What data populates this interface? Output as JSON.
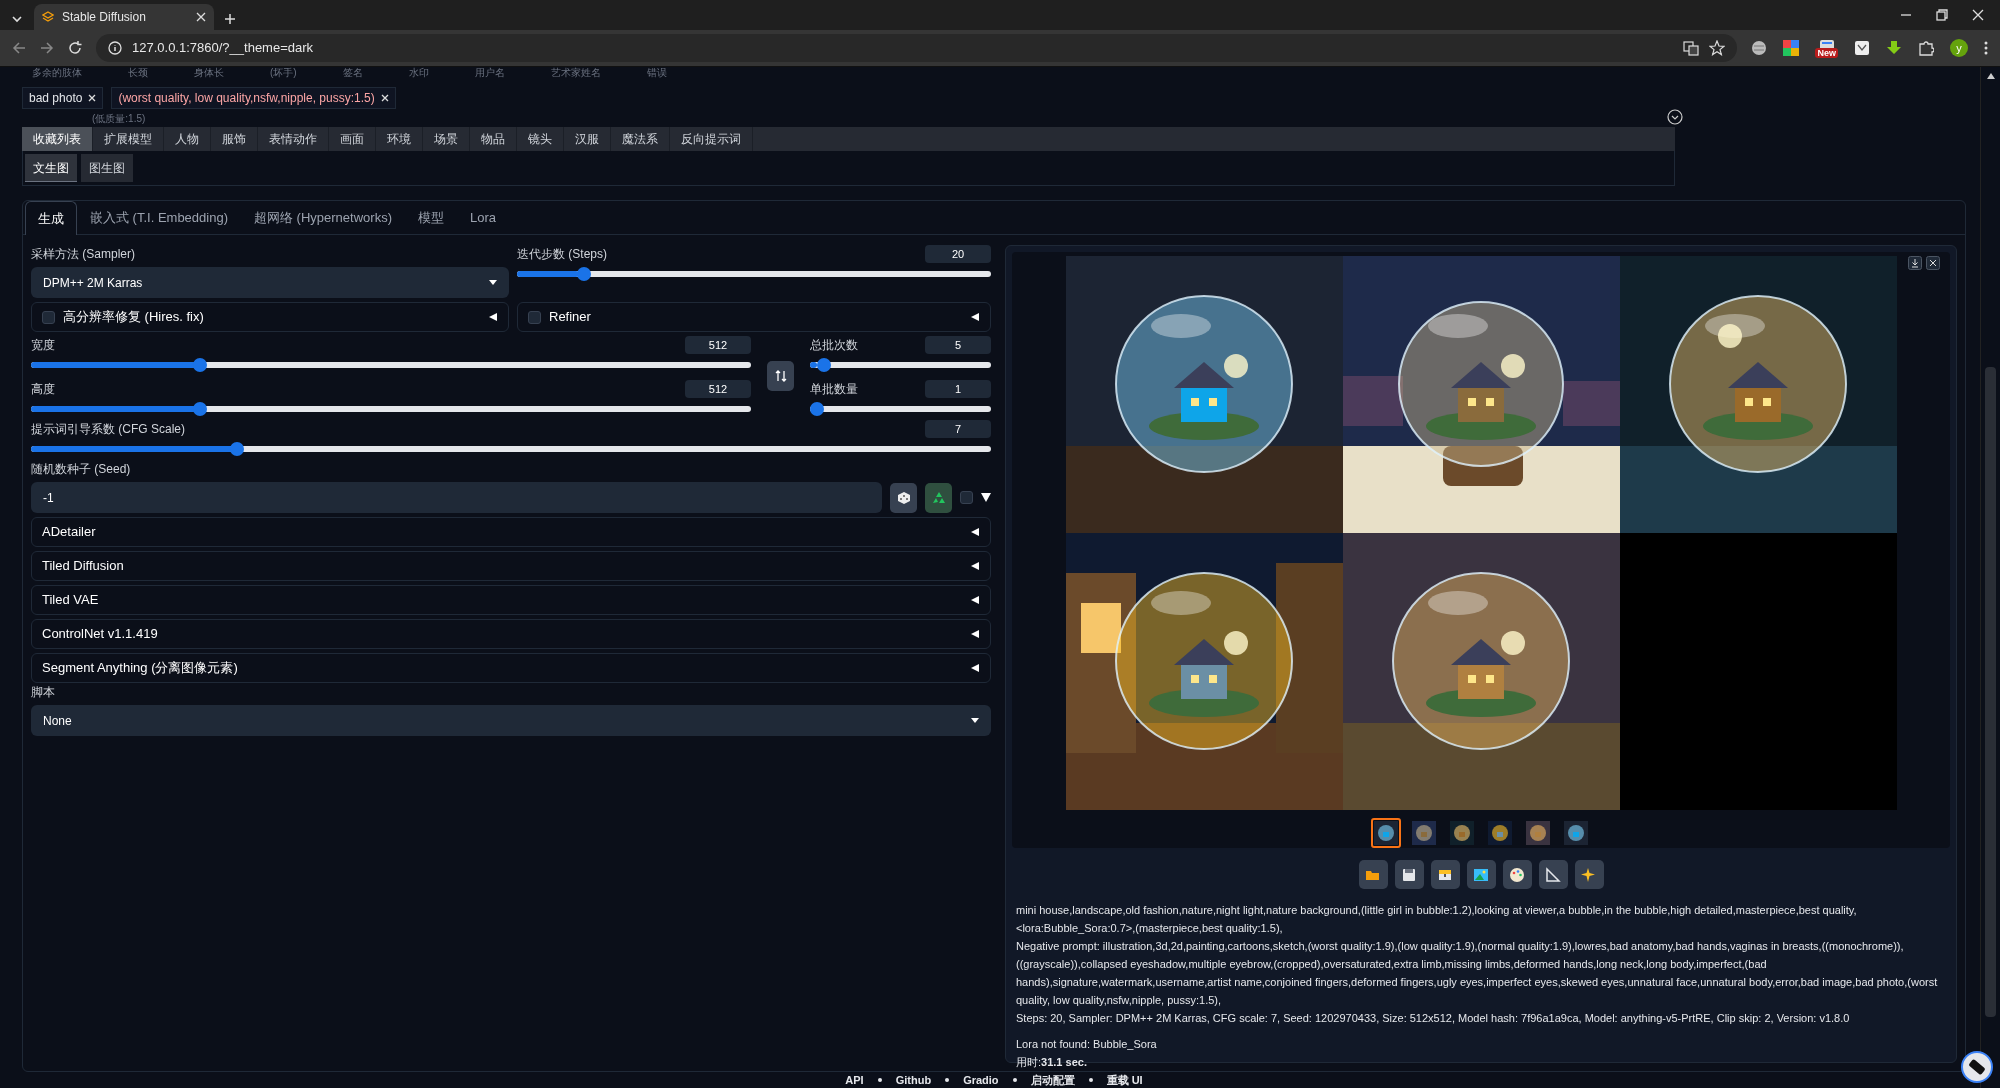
{
  "browser": {
    "tab_title": "Stable Diffusion",
    "url": "127.0.0.1:7860/?__theme=dark",
    "badge": "New",
    "profile_initial": "y"
  },
  "cut_tags": [
    "多余的肢体",
    "长颈",
    "身体长",
    "(坏手)",
    "签名",
    "水印",
    "用户名",
    "艺术家姓名",
    "错误"
  ],
  "prompt_tags": [
    {
      "label": "bad photo",
      "weighted": false
    },
    {
      "label": "(worst quality, low quality,nsfw,nipple, pussy:1.5)",
      "weighted": true
    }
  ],
  "tag_note": "(低质量:1.5)",
  "category_tabs": [
    {
      "label": "收藏列表",
      "selected": true
    },
    {
      "label": "扩展模型",
      "selected": false
    },
    {
      "label": "人物",
      "selected": false
    },
    {
      "label": "服饰",
      "selected": false
    },
    {
      "label": "表情动作",
      "selected": false
    },
    {
      "label": "画面",
      "selected": false
    },
    {
      "label": "环境",
      "selected": false
    },
    {
      "label": "场景",
      "selected": false
    },
    {
      "label": "物品",
      "selected": false
    },
    {
      "label": "镜头",
      "selected": false
    },
    {
      "label": "汉服",
      "selected": false
    },
    {
      "label": "魔法系",
      "selected": false
    },
    {
      "label": "反向提示词",
      "selected": false
    }
  ],
  "sub_tabs": [
    {
      "label": "文生图",
      "selected": true
    },
    {
      "label": "图生图",
      "selected": false
    }
  ],
  "main_tabs": [
    {
      "label": "生成",
      "selected": true
    },
    {
      "label": "嵌入式 (T.I. Embedding)",
      "selected": false
    },
    {
      "label": "超网络 (Hypernetworks)",
      "selected": false
    },
    {
      "label": "模型",
      "selected": false
    },
    {
      "label": "Lora",
      "selected": false
    }
  ],
  "sampler": {
    "label": "采样方法 (Sampler)",
    "value": "DPM++ 2M Karras"
  },
  "steps": {
    "label": "迭代步数 (Steps)",
    "value": "20",
    "level": 0.13
  },
  "toggles": [
    {
      "label": "高分辨率修复 (Hires. fix)",
      "checked": false
    },
    {
      "label": "Refiner",
      "checked": false
    }
  ],
  "size_sliders": [
    {
      "label": "宽度",
      "value": "512",
      "level": 0.23
    },
    {
      "label": "高度",
      "value": "512",
      "level": 0.23
    }
  ],
  "batch_sliders": [
    {
      "label": "总批次数",
      "value": "5",
      "level": 0.04
    },
    {
      "label": "单批数量",
      "value": "1",
      "level": 0
    }
  ],
  "cfg": {
    "label": "提示词引导系数 (CFG Scale)",
    "value": "7",
    "level": 0.21
  },
  "seed": {
    "label": "随机数种子 (Seed)",
    "value": "-1",
    "extra_checked": false
  },
  "accordions": [
    "ADetailer",
    "Tiled Diffusion",
    "Tiled VAE",
    "ControlNet v1.1.419",
    "Segment Anything (分离图像元素)"
  ],
  "script": {
    "label": "脚本",
    "value": "None"
  },
  "gallery": {
    "thumbnails": [
      {
        "selected": true
      },
      {
        "selected": false
      },
      {
        "selected": false
      },
      {
        "selected": false
      },
      {
        "selected": false
      },
      {
        "selected": false
      }
    ]
  },
  "info": {
    "prompt": "mini house,landscape,old fashion,nature,night light,nature background,(little girl in bubble:1.2),looking at viewer,a bubble,in the bubble,high detailed,masterpiece,best quality,<lora:Bubble_Sora:0.7>,(masterpiece,best quality:1.5),",
    "negative": "Negative prompt: illustration,3d,2d,painting,cartoons,sketch,(worst quality:1.9),(low quality:1.9),(normal quality:1.9),lowres,bad anatomy,bad hands,vaginas in breasts,((monochrome)),((grayscale)),collapsed eyeshadow,multiple eyebrow,(cropped),oversaturated,extra limb,missing limbs,deformed hands,long neck,long body,imperfect,(bad hands),signature,watermark,username,artist name,conjoined fingers,deformed fingers,ugly eyes,imperfect eyes,skewed eyes,unnatural face,unnatural body,error,bad image,bad photo,(worst quality, low quality,nsfw,nipple, pussy:1.5),",
    "params": "Steps: 20, Sampler: DPM++ 2M Karras, CFG scale: 7, Seed: 1202970433, Size: 512x512, Model hash: 7f96a1a9ca, Model: anything-v5-PrtRE, Clip skip: 2, Version: v1.8.0",
    "note": "Lora not found: Bubble_Sora",
    "time": "用时:**31.1 sec.**"
  },
  "footer": [
    "API",
    "Github",
    "Gradio",
    "启动配置",
    "重载 UI"
  ]
}
